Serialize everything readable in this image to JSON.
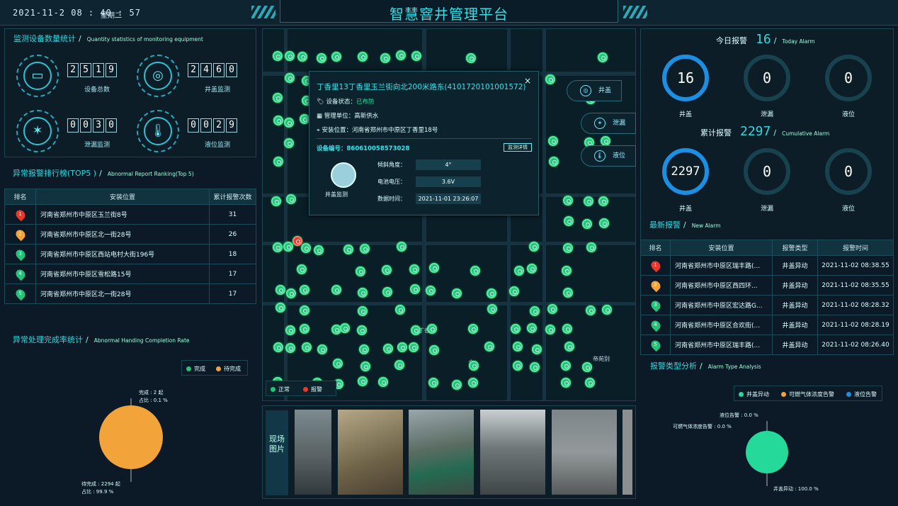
{
  "header": {
    "title": "智慧窨井管理平台",
    "datetime": "2021-11-2 08 : 40 : 57",
    "weekday": "星期二"
  },
  "monitor_stats": {
    "title": "监测设备数量统计",
    "title_en": "Quantity statistics of monitoring equipment",
    "items": [
      {
        "label": "设备总数",
        "digits": [
          "2",
          "5",
          "1",
          "9"
        ],
        "icon": "router-icon"
      },
      {
        "label": "井盖监测",
        "digits": [
          "2",
          "4",
          "6",
          "0"
        ],
        "icon": "manhole-icon"
      },
      {
        "label": "泄漏监测",
        "digits": [
          "0",
          "0",
          "3",
          "0"
        ],
        "icon": "leak-icon"
      },
      {
        "label": "液位监测",
        "digits": [
          "0",
          "0",
          "2",
          "9"
        ],
        "icon": "thermometer-icon"
      }
    ]
  },
  "ranking": {
    "title": "异常报警排行榜(TOP5 )",
    "title_en": "Abnormal Report Ranking(Top 5)",
    "headers": [
      "排名",
      "安装位置",
      "累计报警次数"
    ],
    "rows": [
      {
        "rank": "1",
        "location": "河南省郑州市中原区玉兰街8号",
        "count": "31",
        "color": "#e8392c"
      },
      {
        "rank": "2",
        "location": "河南省郑州市中原区北一街28号",
        "count": "26",
        "color": "#f2a43a"
      },
      {
        "rank": "3",
        "location": "河南省郑州市中原区西站电村大街196号",
        "count": "18",
        "color": "#25c27a"
      },
      {
        "rank": "4",
        "location": "河南省郑州市中原区雪松路15号",
        "count": "17",
        "color": "#25c27a"
      },
      {
        "rank": "5",
        "location": "河南省郑州市中原区北一街28号",
        "count": "17",
        "color": "#25c27a"
      }
    ]
  },
  "completion": {
    "title": "异常处理完成率统计",
    "title_en": "Abnormal Handing Completion Rate",
    "legend": [
      {
        "name": "完成",
        "color": "#25c27a"
      },
      {
        "name": "待完成",
        "color": "#f2a43a"
      }
    ],
    "label_done_1": "完成 : 2 起",
    "label_done_2": "占比 : 0.1 %",
    "label_pending_1": "待完成 : 2294 起",
    "label_pending_2": "占比 : 99.9 %"
  },
  "map": {
    "popup": {
      "title": "丁香里13丁香里玉兰街向北200米路东(4101720101001572)",
      "status_label": "设备状态：",
      "status_value": "已布防",
      "unit_label": "管理单位：",
      "unit_value": "高新供水",
      "address_label": "安装位置：",
      "address_value": "河南省郑州市中原区丁香里18号",
      "code_label": "设备编号：",
      "code_value": "860610058573028",
      "detail_button": "监测详情",
      "device_type": "井盖监测",
      "rows": [
        {
          "key": "倾斜角度：",
          "value": "4°"
        },
        {
          "key": "电池电压：",
          "value": "3.6V"
        },
        {
          "key": "数据时间：",
          "value": "2021-11-01 23:26:07"
        }
      ],
      "close": "×"
    },
    "side_buttons": [
      {
        "label": "井盖",
        "icon": "manhole-icon"
      },
      {
        "label": "泄漏",
        "icon": "leak-icon"
      },
      {
        "label": "液位",
        "icon": "thermometer-icon"
      }
    ],
    "legend": [
      {
        "name": "正常",
        "color": "#25c27a"
      },
      {
        "name": "报警",
        "color": "#e8392c"
      }
    ],
    "road_labels": [
      "帝苑别",
      "丁香",
      "合"
    ]
  },
  "photos": {
    "label": "现场图片"
  },
  "today_alarm": {
    "title": "今日报警",
    "count": "16",
    "title_en": "Today Alarm",
    "gauges": [
      {
        "value": "16",
        "label": "井盖"
      },
      {
        "value": "0",
        "label": "泄漏"
      },
      {
        "value": "0",
        "label": "液位"
      }
    ]
  },
  "cumulative_alarm": {
    "title": "累计报警",
    "count": "2297",
    "title_en": "Cumulative Alarm",
    "gauges": [
      {
        "value": "2297",
        "label": "井盖"
      },
      {
        "value": "0",
        "label": "泄漏"
      },
      {
        "value": "0",
        "label": "液位"
      }
    ]
  },
  "new_alarm": {
    "title": "最新报警",
    "title_en": "New Alarm",
    "headers": [
      "排名",
      "安装位置",
      "报警类型",
      "报警时间"
    ],
    "rows": [
      {
        "rank": "1",
        "location": "河南省郑州市中原区瑞丰路(...",
        "type": "井盖异动",
        "time": "2021-11-02 08:38.55",
        "color": "#e8392c"
      },
      {
        "rank": "2",
        "location": "河南省郑州市中原区西四环...",
        "type": "井盖异动",
        "time": "2021-11-02 08:35.55",
        "color": "#f2a43a"
      },
      {
        "rank": "3",
        "location": "河南省郑州市中原区宏达路G...",
        "type": "井盖异动",
        "time": "2021-11-02 08:28.32",
        "color": "#25c27a"
      },
      {
        "rank": "4",
        "location": "河南省郑州市中原区合欢街(...",
        "type": "井盖异动",
        "time": "2021-11-02 08:28.19",
        "color": "#25c27a"
      },
      {
        "rank": "5",
        "location": "河南省郑州市中原区瑞丰路(...",
        "type": "井盖异动",
        "time": "2021-11-02 08:26.40",
        "color": "#25c27a"
      }
    ]
  },
  "alarm_type": {
    "title": "报警类型分析",
    "title_en": "Alarm Type Analysis",
    "legend": [
      {
        "name": "井盖异动",
        "color": "#25d99a"
      },
      {
        "name": "可燃气体浓度告警",
        "color": "#f2a43a"
      },
      {
        "name": "液位告警",
        "color": "#1d8fe3"
      }
    ],
    "label_liquid": "液位告警 : 0.0 %",
    "label_gas": "可燃气体浓度告警 : 0.0 %",
    "label_cover": "井盖异动 : 100.0 %"
  },
  "chart_data": [
    {
      "type": "pie",
      "categories": [
        "完成",
        "待完成"
      ],
      "values": [
        2,
        2294
      ]
    },
    {
      "type": "pie",
      "categories": [
        "井盖异动",
        "可燃气体浓度告警",
        "液位告警"
      ],
      "values": [
        100.0,
        0.0,
        0.0
      ]
    }
  ]
}
